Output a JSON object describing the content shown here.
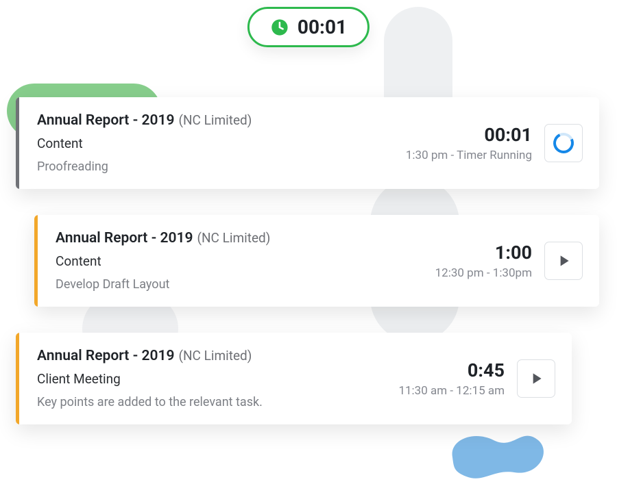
{
  "timer": {
    "value": "00:01"
  },
  "tasks": [
    {
      "title": "Annual Report - 2019",
      "org": "(NC Limited)",
      "section": "Content",
      "note": "Proofreading",
      "duration": "00:01",
      "range": "1:30 pm - Timer Running",
      "accent": "gray",
      "running": true
    },
    {
      "title": "Annual Report - 2019",
      "org": "(NC Limited)",
      "section": "Content",
      "note": "Develop Draft Layout",
      "duration": "1:00",
      "range": "12:30 pm - 1:30pm",
      "accent": "orange",
      "running": false
    },
    {
      "title": "Annual Report - 2019",
      "org": "(NC Limited)",
      "section": "Client Meeting",
      "note": "Key points are added to the relevant task.",
      "duration": "0:45",
      "range": "11:30 am - 12:15 am",
      "accent": "orange",
      "running": false
    }
  ]
}
